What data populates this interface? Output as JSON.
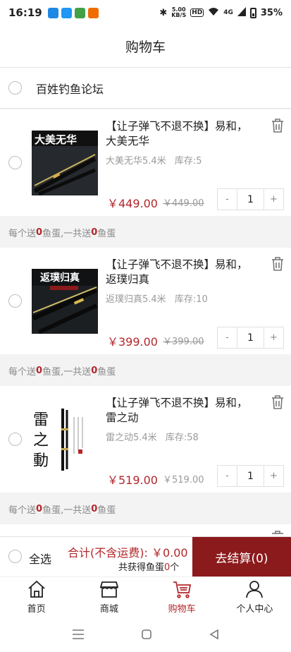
{
  "status_bar": {
    "time": "16:19",
    "net_speed": "5.00",
    "net_unit": "KB/S",
    "hd": "HD",
    "signal": "4G",
    "battery": "35%"
  },
  "header": {
    "title": "购物车"
  },
  "shop": {
    "name": "百姓钓鱼论坛"
  },
  "items": [
    {
      "title": "【让子弹飞不退不换】易和，大美无华",
      "spec": "大美无华5.4米",
      "stock": "库存:5",
      "price": "￥449.00",
      "old_price": "￥449.00",
      "qty": "1",
      "minus": "-",
      "plus": "+",
      "image_text": "大美无华",
      "gift_prefix": "每个送",
      "gift_a": "0",
      "gift_mid": "鱼蛋,一共送",
      "gift_b": "0",
      "gift_suffix": "鱼蛋"
    },
    {
      "title": "【让子弹飞不退不换】易和，返璞归真",
      "spec": "返璞归真5.4米",
      "stock": "库存:10",
      "price": "￥399.00",
      "old_price": "￥399.00",
      "qty": "1",
      "minus": "-",
      "plus": "+",
      "image_text": "返璞归真",
      "gift_prefix": "每个送",
      "gift_a": "0",
      "gift_mid": "鱼蛋,一共送",
      "gift_b": "0",
      "gift_suffix": "鱼蛋"
    },
    {
      "title": "【让子弹飞不退不换】易和，雷之动",
      "spec": "雷之动5.4米",
      "stock": "库存:58",
      "price": "￥519.00",
      "old_price": "￥519.00",
      "qty": "1",
      "minus": "-",
      "plus": "+",
      "image_text": "雷之動",
      "gift_prefix": "每个送",
      "gift_a": "0",
      "gift_mid": "鱼蛋,一共送",
      "gift_b": "0",
      "gift_suffix": "鱼蛋"
    }
  ],
  "checkout": {
    "select_all": "全选",
    "total": "合计(不含运费): ￥0.00",
    "eggs_prefix": "共获得鱼蛋",
    "eggs_count": "0",
    "eggs_suffix": "个",
    "button": "去结算(0)"
  },
  "tabs": [
    {
      "label": "首页",
      "icon": "home-icon"
    },
    {
      "label": "商城",
      "icon": "shop-icon"
    },
    {
      "label": "购物车",
      "icon": "cart-icon",
      "active": true
    },
    {
      "label": "个人中心",
      "icon": "user-icon"
    }
  ],
  "colors": {
    "accent": "#b3262a",
    "checkout_button": "#8b1a1c"
  }
}
